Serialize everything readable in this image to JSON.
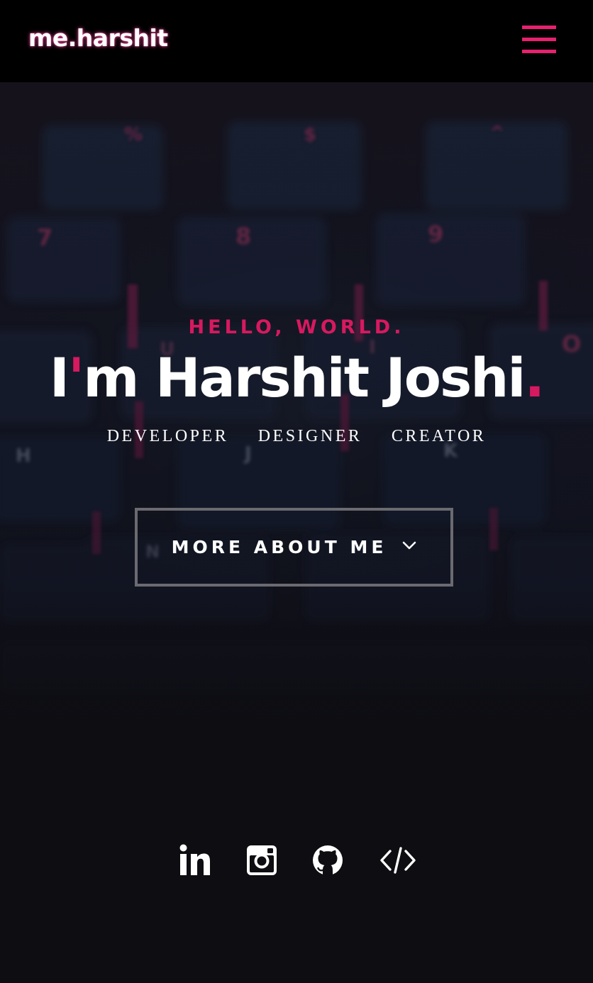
{
  "header": {
    "logo": "me.harshit",
    "menu_icon": "hamburger-menu-icon"
  },
  "hero": {
    "greeting": "HELLO, WORLD.",
    "name_prefix": "I",
    "name_apostrophe": "'",
    "name_rest": "m Harshit Joshi",
    "name_dot": ".",
    "roles": [
      "DEVELOPER",
      "DESIGNER",
      "CREATOR"
    ],
    "cta_label": "MORE ABOUT ME",
    "cta_icon": "chevron-down-icon"
  },
  "social": [
    {
      "name": "linkedin-icon"
    },
    {
      "name": "instagram-icon"
    },
    {
      "name": "github-icon"
    },
    {
      "name": "code-icon"
    }
  ],
  "colors": {
    "accent": "#d7195f",
    "menu": "#e8206f",
    "header_bg": "#000000",
    "page_bg": "#0d0d12",
    "button_border": "#6a6a70"
  }
}
